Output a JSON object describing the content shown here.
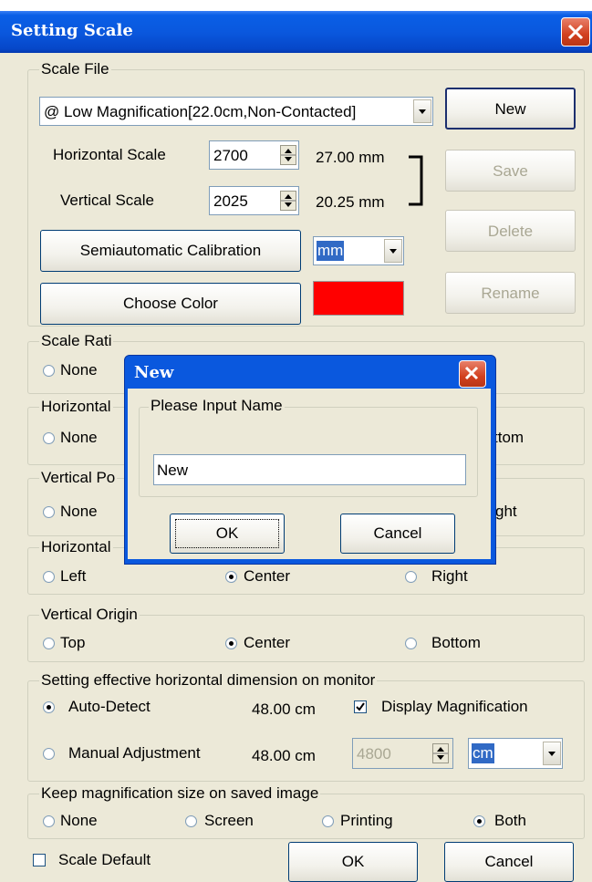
{
  "window": {
    "title": "Setting Scale"
  },
  "scale_file": {
    "legend": "Scale File",
    "selected_file": "@ Low Magnification[22.0cm,Non-Contacted]",
    "buttons": {
      "new": "New",
      "save": "Save",
      "delete": "Delete",
      "rename": "Rename"
    },
    "horizontal": {
      "label": "Horizontal Scale",
      "value": "2700",
      "mm": "27.00 mm"
    },
    "vertical": {
      "label": "Vertical Scale",
      "value": "2025",
      "mm": "20.25 mm"
    },
    "calibration_button": "Semiautomatic Calibration",
    "unit": "mm",
    "color_button": "Choose Color",
    "color": "#ff0000"
  },
  "scale_ratio": {
    "legend": "Scale Rati",
    "none": "None"
  },
  "horizontal_pos": {
    "legend": "Horizontal",
    "none": "None",
    "right_text": "ttom"
  },
  "vertical_pos": {
    "legend": "Vertical Po",
    "none": "None",
    "right_text": "ght"
  },
  "horizontal_origin": {
    "legend": "Horizontal",
    "left": "Left",
    "center": "Center",
    "right": "Right",
    "selected": "Center"
  },
  "vertical_origin": {
    "legend": "Vertical Origin",
    "top": "Top",
    "center": "Center",
    "bottom": "Bottom",
    "selected": "Center"
  },
  "monitor": {
    "legend": "Setting effective horizontal dimension on monitor",
    "auto": {
      "label": "Auto-Detect",
      "value": "48.00 cm"
    },
    "display_magnification": "Display Magnification",
    "manual": {
      "label": "Manual Adjustment",
      "value": "48.00 cm",
      "spin_value": "4800",
      "unit": "cm"
    }
  },
  "keep": {
    "legend": "Keep magnification size on saved image",
    "none": "None",
    "screen": "Screen",
    "printing": "Printing",
    "both": "Both",
    "selected": "Both"
  },
  "footer": {
    "scale_default": "Scale Default",
    "ok": "OK",
    "cancel": "Cancel"
  },
  "new_dialog": {
    "title": "New",
    "legend": "Please Input Name",
    "input_value": "New",
    "ok": "OK",
    "cancel": "Cancel"
  },
  "colors": {
    "title_blue": "#0a58de",
    "dialog_bg": "#ece9d8",
    "close_red": "#d2401f"
  }
}
